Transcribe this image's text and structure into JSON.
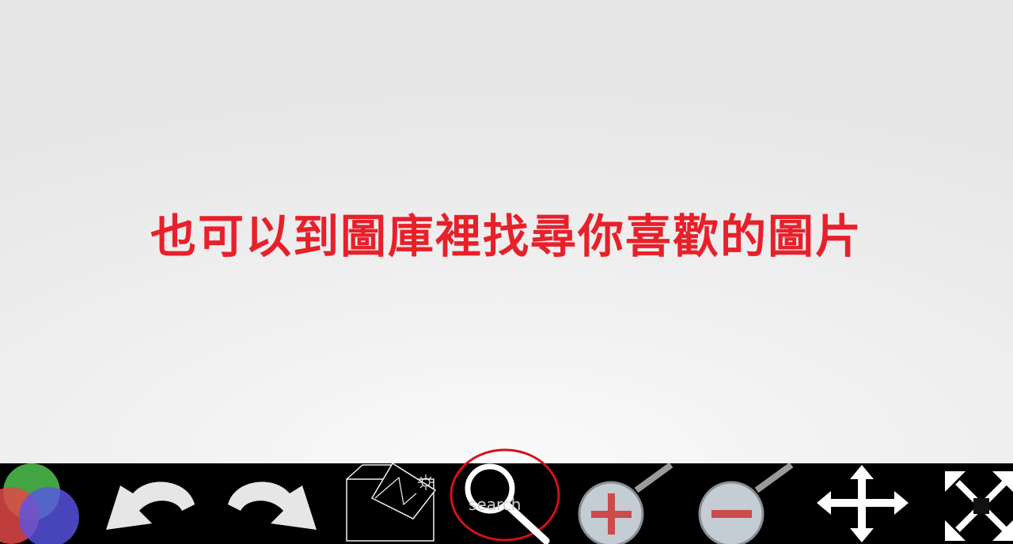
{
  "message": "也可以到圖庫裡找尋你喜歡的圖片",
  "colors": {
    "message": "#e8202a",
    "toolbar_bg": "#000000",
    "highlight_ring": "#d4101a",
    "zoom_plus": "#cc4b4b",
    "zoom_lens": "#c4ccd4"
  },
  "toolbar": {
    "tools": [
      {
        "name": "color-palette",
        "icon": "color-circles-icon"
      },
      {
        "name": "undo",
        "icon": "undo-arrow-icon"
      },
      {
        "name": "redo",
        "icon": "redo-arrow-icon"
      },
      {
        "name": "gallery",
        "icon": "picture-box-icon"
      },
      {
        "name": "search",
        "icon": "magnifier-icon",
        "label": "search",
        "highlighted": true
      },
      {
        "name": "zoom-in",
        "icon": "zoom-in-icon"
      },
      {
        "name": "zoom-out",
        "icon": "zoom-out-icon"
      },
      {
        "name": "move",
        "icon": "move-arrows-icon"
      },
      {
        "name": "fullscreen",
        "icon": "expand-arrows-icon"
      }
    ]
  }
}
